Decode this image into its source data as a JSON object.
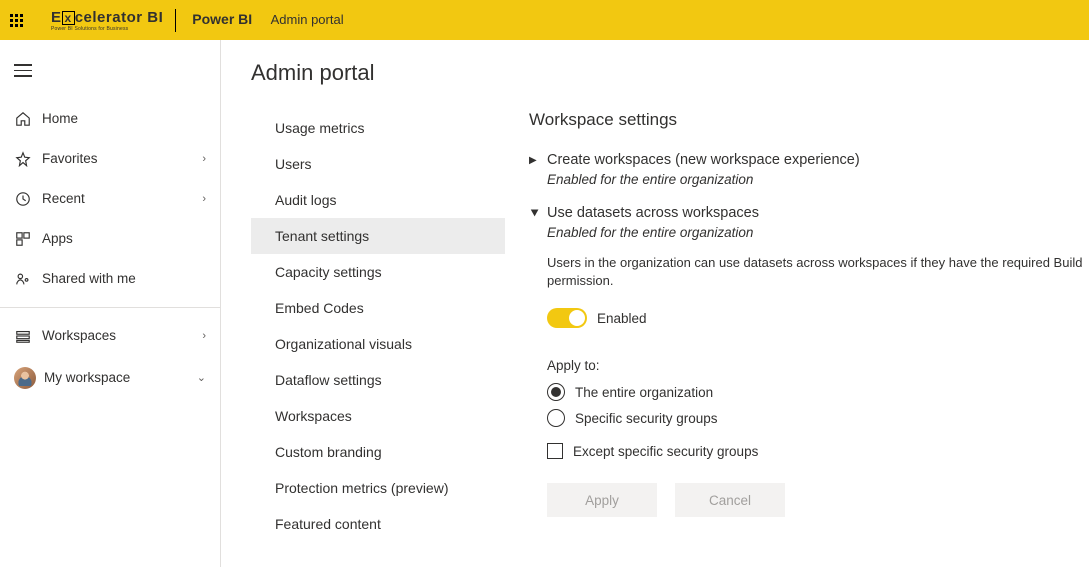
{
  "topbar": {
    "product_logo_main": "Excelerator BI",
    "product_logo_tag": "Power BI Solutions for Business",
    "app": "Power BI",
    "page": "Admin portal"
  },
  "sidebar": {
    "items": [
      {
        "label": "Home",
        "chev": ""
      },
      {
        "label": "Favorites",
        "chev": "›"
      },
      {
        "label": "Recent",
        "chev": "›"
      },
      {
        "label": "Apps",
        "chev": ""
      },
      {
        "label": "Shared with me",
        "chev": ""
      }
    ],
    "lower": [
      {
        "label": "Workspaces",
        "chev": "›"
      },
      {
        "label": "My workspace",
        "chev": "⌄"
      }
    ]
  },
  "main": {
    "title": "Admin portal",
    "nav": [
      "Usage metrics",
      "Users",
      "Audit logs",
      "Tenant settings",
      "Capacity settings",
      "Embed Codes",
      "Organizational visuals",
      "Dataflow settings",
      "Workspaces",
      "Custom branding",
      "Protection metrics (preview)",
      "Featured content"
    ],
    "nav_active_index": 3
  },
  "content": {
    "section_title": "Workspace settings",
    "block1": {
      "label": "Create workspaces (new workspace experience)",
      "status": "Enabled for the entire organization"
    },
    "block2": {
      "label": "Use datasets across workspaces",
      "status": "Enabled for the entire organization",
      "desc": "Users in the organization can use datasets across workspaces if they have the required Build permission.",
      "switch_label": "Enabled",
      "apply_label": "Apply to:",
      "opt1": "The entire organization",
      "opt2": "Specific security groups",
      "opt3": "Except specific security groups",
      "btn_apply": "Apply",
      "btn_cancel": "Cancel"
    }
  }
}
